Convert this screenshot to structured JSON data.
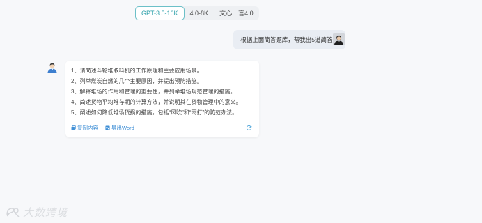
{
  "models": {
    "tabs": [
      {
        "label": "GPT-3.5-16K",
        "active": true
      },
      {
        "label": "4.0-8K",
        "active": false
      },
      {
        "label": "文心一言4.0",
        "active": false
      }
    ]
  },
  "user_message": {
    "text": "根据上面简答题库，帮我出5道简答题"
  },
  "assistant_message": {
    "questions": [
      "1、请简述斗轮堆取料机的工作原理和主要应用场景。",
      "2、列举煤炭自燃的几个主要原因，并提出预防措施。",
      "3、解释堆场的作用和管理的重要性，并列举堆场规范管理的措施。",
      "4、简述货物平均堆存期的计算方法，并说明其在货物管理中的意义。",
      "5、阐述如何降低堆场货损的措施，包括“风吹”和“雨打”的防范办法。"
    ],
    "actions": {
      "copy_label": "复制内容",
      "export_label": "导出Word"
    }
  },
  "watermark": {
    "text": "大数跨境"
  },
  "colors": {
    "accent": "#2a9fa8",
    "link": "#3f8fd6",
    "background": "#f7f8fa"
  }
}
